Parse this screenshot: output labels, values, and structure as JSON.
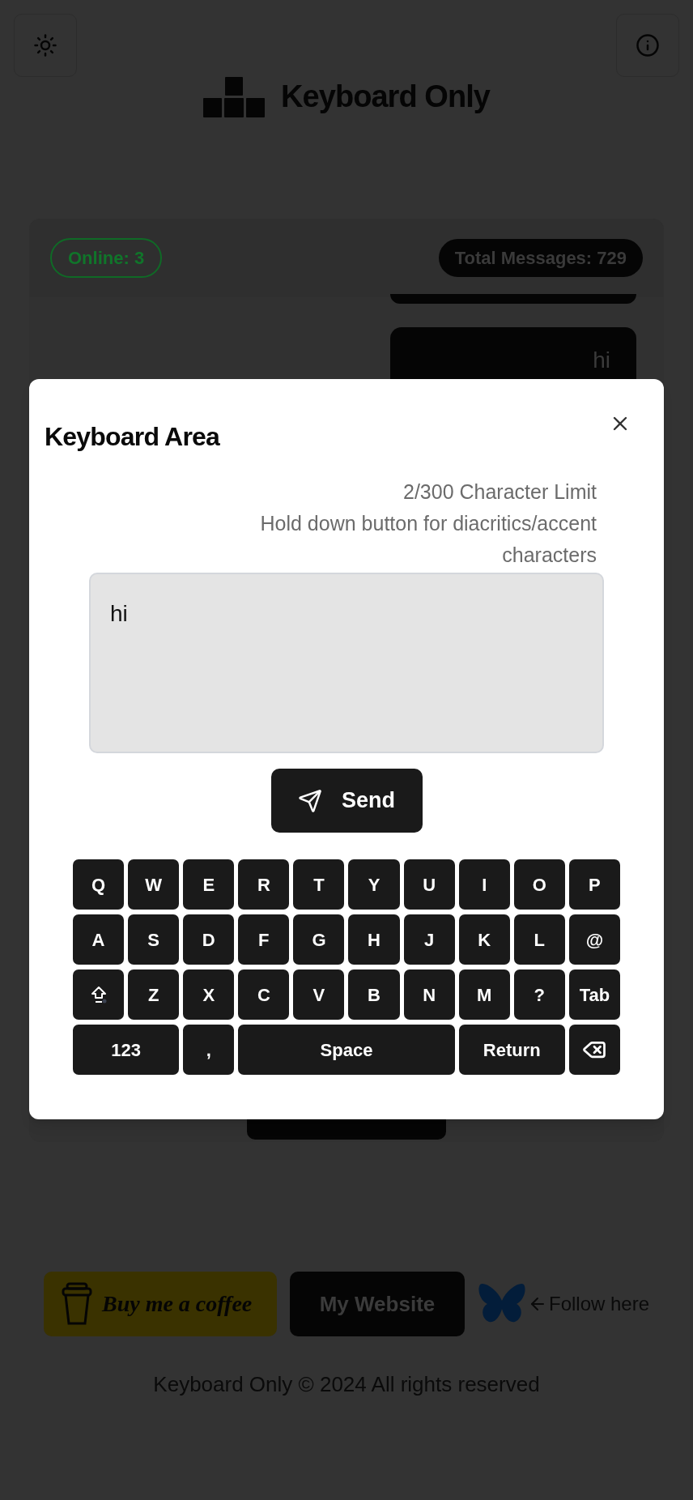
{
  "logo": {
    "title": "Keyboard Only"
  },
  "chat": {
    "online": "Online: 3",
    "total": "Total Messages: 729",
    "messages": [
      {
        "text": "hi"
      }
    ]
  },
  "modal": {
    "title": "Keyboard Area",
    "char_limit": "2/300 Character Limit",
    "hint": "Hold down button for diacritics/accent characters",
    "input": {
      "value": "hi"
    },
    "send": "Send",
    "keys": [
      [
        {
          "kind": "key",
          "label": "Q"
        },
        {
          "kind": "key",
          "label": "W"
        },
        {
          "kind": "key",
          "label": "E"
        },
        {
          "kind": "key",
          "label": "R"
        },
        {
          "kind": "key",
          "label": "T"
        },
        {
          "kind": "key",
          "label": "Y"
        },
        {
          "kind": "key",
          "label": "U"
        },
        {
          "kind": "key",
          "label": "I"
        },
        {
          "kind": "key",
          "label": "O"
        },
        {
          "kind": "key",
          "label": "P"
        }
      ],
      [
        {
          "kind": "key",
          "label": "A"
        },
        {
          "kind": "key",
          "label": "S"
        },
        {
          "kind": "key",
          "label": "D"
        },
        {
          "kind": "key",
          "label": "F"
        },
        {
          "kind": "key",
          "label": "G"
        },
        {
          "kind": "key",
          "label": "H"
        },
        {
          "kind": "key",
          "label": "J"
        },
        {
          "kind": "key",
          "label": "K"
        },
        {
          "kind": "key",
          "label": "L"
        },
        {
          "kind": "key",
          "label": "@"
        }
      ],
      [
        {
          "kind": "shift"
        },
        {
          "kind": "key",
          "label": "Z"
        },
        {
          "kind": "key",
          "label": "X"
        },
        {
          "kind": "key",
          "label": "C"
        },
        {
          "kind": "key",
          "label": "V"
        },
        {
          "kind": "key",
          "label": "B"
        },
        {
          "kind": "key",
          "label": "N"
        },
        {
          "kind": "key",
          "label": "M"
        },
        {
          "kind": "key",
          "label": "?"
        },
        {
          "kind": "key",
          "label": "Tab"
        }
      ],
      [
        {
          "kind": "wide",
          "label": "123"
        },
        {
          "kind": "key",
          "label": ","
        },
        {
          "kind": "space",
          "label": "Space"
        },
        {
          "kind": "wide",
          "label": "Return"
        },
        {
          "kind": "backspace"
        }
      ]
    ]
  },
  "footer": {
    "coffee": "Buy me a coffee",
    "website": "My Website",
    "follow": "Follow here",
    "copyright": "Keyboard Only © 2024 All rights reserved"
  }
}
